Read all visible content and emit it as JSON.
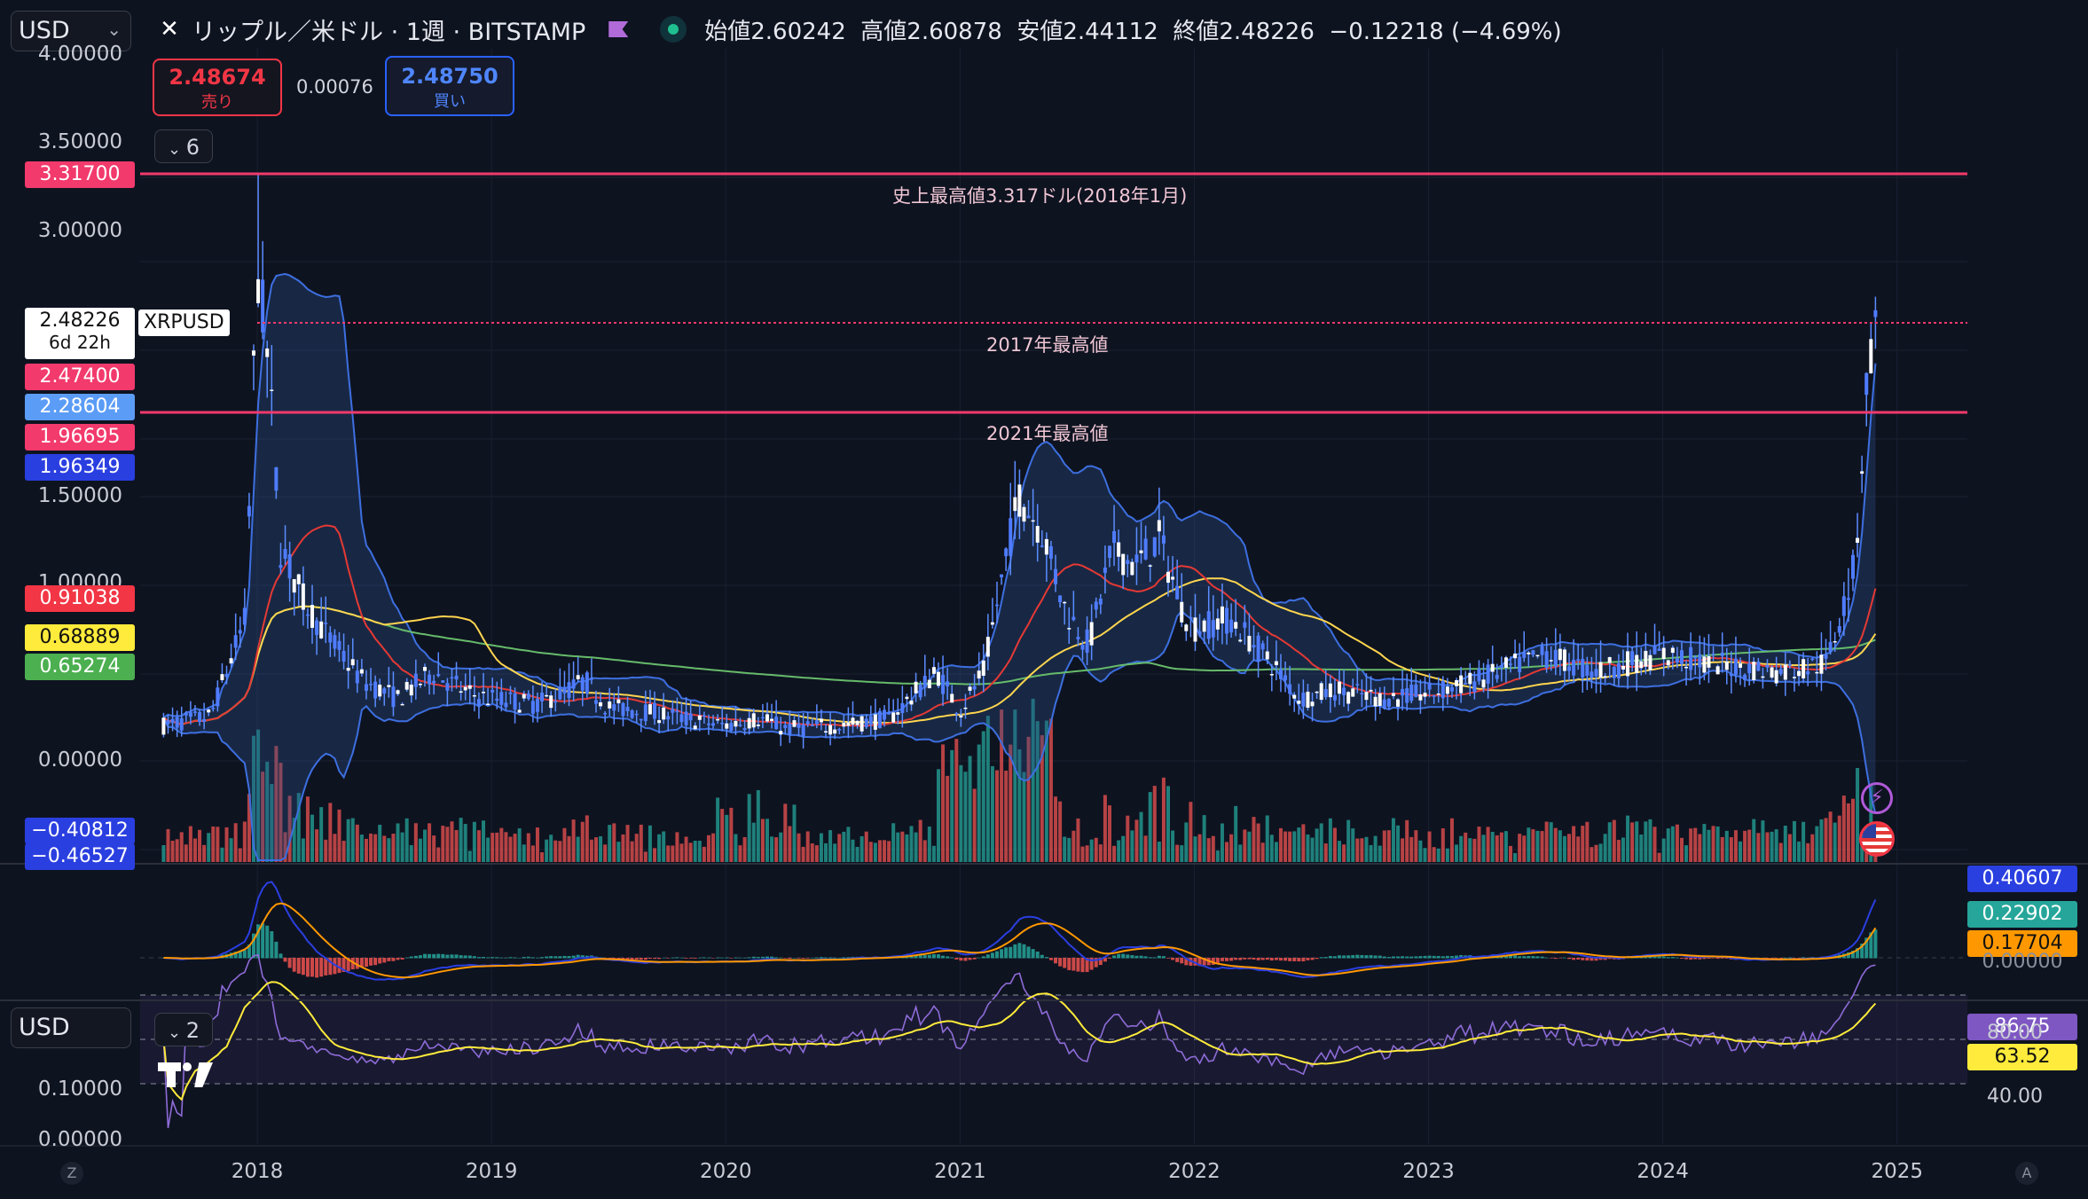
{
  "header": {
    "currency": "USD",
    "symbol_title": "リップル／米ドル · 1週 · BITSTAMP",
    "ohlc": "始値2.60242  高値2.60878  安値2.44112  終値2.48226  −0.12218 (−4.69%)"
  },
  "trade": {
    "sell_price": "2.48674",
    "sell_label": "売り",
    "spread": "0.00076",
    "buy_price": "2.48750",
    "buy_label": "買い"
  },
  "indicator_collapse": "6",
  "rsi_collapse": "2",
  "bottom_currency": "USD",
  "annotations": {
    "ath": "史上最高値3.317ドル(2018年1月)",
    "high2017": "2017年最高値",
    "high2021": "2021年最高値"
  },
  "price_axis": [
    "4.00000",
    "3.50000",
    "3.00000",
    "1.50000",
    "1.00000",
    "0.00000"
  ],
  "price_badges": [
    {
      "text": "3.31700",
      "color": "#f23a6c",
      "fg": "#ffffff"
    },
    {
      "text": "2.47400",
      "color": "#f23a6c",
      "fg": "#ffffff"
    },
    {
      "text": "2.28604",
      "color": "#5b9cf6",
      "fg": "#ffffff"
    },
    {
      "text": "1.96695",
      "color": "#f23a6c",
      "fg": "#ffffff"
    },
    {
      "text": "1.96349",
      "color": "#2a3fe0",
      "fg": "#ffffff"
    },
    {
      "text": "0.91038",
      "color": "#f23645",
      "fg": "#ffffff"
    },
    {
      "text": "0.68889",
      "color": "#ffeb3b",
      "fg": "#111111"
    },
    {
      "text": "0.65274",
      "color": "#4caf50",
      "fg": "#ffffff"
    },
    {
      "text": "−0.40812",
      "color": "#2a3fe0",
      "fg": "#ffffff"
    },
    {
      "text": "−0.46527",
      "color": "#2a3fe0",
      "fg": "#ffffff"
    }
  ],
  "last_price": {
    "value": "2.48226",
    "countdown": "6d 22h",
    "symbol": "XRPUSD"
  },
  "macd_badges": [
    {
      "text": "0.40607",
      "color": "#2a3fe0",
      "fg": "#ffffff"
    },
    {
      "text": "0.22902",
      "color": "#26a69a",
      "fg": "#ffffff"
    },
    {
      "text": "0.17704",
      "color": "#ff9800",
      "fg": "#111111"
    },
    {
      "text": "0.00000",
      "color": "",
      "fg": "#8a8f9c"
    }
  ],
  "rsi_axis": [
    "80.00",
    "40.00"
  ],
  "rsi_badges": [
    {
      "text": "86.75",
      "color": "#7e57c2",
      "fg": "#ffffff"
    },
    {
      "text": "63.52",
      "color": "#ffeb3b",
      "fg": "#111111"
    }
  ],
  "lower_axis": [
    "0.10000",
    "0.00000"
  ],
  "x_axis": [
    "2018",
    "2019",
    "2020",
    "2021",
    "2022",
    "2023",
    "2024",
    "2025"
  ],
  "corner_labels": {
    "left": "Z",
    "right": "A"
  },
  "colors": {
    "background": "#0e1320",
    "hline": "#f23a6c",
    "bb": "#3d6fe0",
    "ema_red": "#e53935",
    "ema_yellow": "#ffd54f",
    "ema_green": "#66bb6a",
    "candle": "#ffffff",
    "vol_up": "#26a69a",
    "vol_down": "#ef5350",
    "rsi": "#8e6bd8",
    "rsi_ma": "#ffeb3b",
    "macd": "#2a3fe0",
    "signal": "#ff9800"
  },
  "chart_data": {
    "type": "candlestick",
    "title": "リップル／米ドル · 1週 · BITSTAMP",
    "xlabel": "",
    "ylabel": "",
    "ylim": [
      -0.5,
      4.0
    ],
    "grid": true,
    "price_levels": [
      {
        "value": 3.317,
        "label": "史上最高値3.317ドル(2018年1月)"
      },
      {
        "value": 2.474,
        "label": "2017年最高値"
      },
      {
        "value": 1.967,
        "label": "2021年最高値"
      }
    ],
    "series": [
      {
        "name": "XRPUSD",
        "x": [
          2017.6,
          2017.8,
          2017.95,
          2018.0,
          2018.05,
          2018.1,
          2018.2,
          2018.3,
          2018.45,
          2018.6,
          2018.75,
          2018.9,
          2019.0,
          2019.2,
          2019.4,
          2019.5,
          2019.7,
          2019.9,
          2020.0,
          2020.15,
          2020.25,
          2020.5,
          2020.7,
          2020.9,
          2021.0,
          2021.1,
          2021.25,
          2021.35,
          2021.45,
          2021.55,
          2021.65,
          2021.75,
          2021.85,
          2021.95,
          2022.0,
          2022.15,
          2022.3,
          2022.45,
          2022.6,
          2022.8,
          2023.0,
          2023.2,
          2023.5,
          2023.7,
          2024.0,
          2024.2,
          2024.5,
          2024.7,
          2024.82,
          2024.88,
          2024.92
        ],
        "values": [
          0.2,
          0.25,
          0.8,
          2.8,
          2.2,
          1.2,
          0.9,
          0.7,
          0.45,
          0.35,
          0.5,
          0.38,
          0.35,
          0.32,
          0.45,
          0.3,
          0.27,
          0.22,
          0.2,
          0.24,
          0.18,
          0.2,
          0.24,
          0.5,
          0.28,
          0.5,
          1.5,
          1.3,
          0.85,
          0.65,
          1.2,
          1.1,
          1.25,
          0.85,
          0.75,
          0.8,
          0.6,
          0.35,
          0.4,
          0.35,
          0.38,
          0.45,
          0.6,
          0.5,
          0.6,
          0.55,
          0.5,
          0.55,
          1.1,
          2.3,
          2.48226
        ]
      }
    ]
  }
}
